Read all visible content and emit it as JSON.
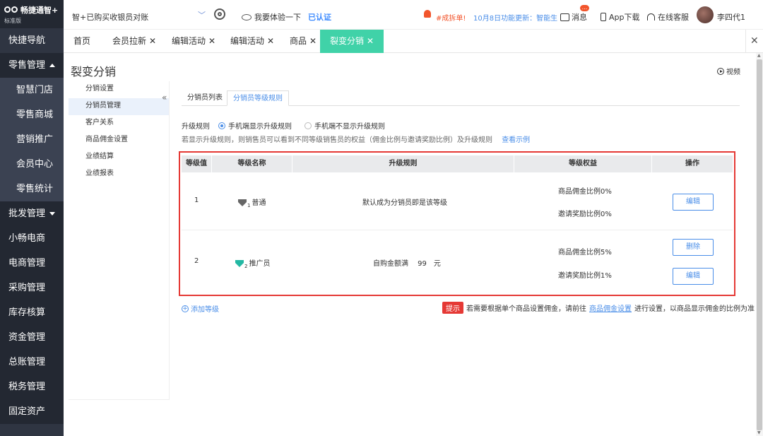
{
  "app": {
    "name": "畅捷通智+",
    "edition": "标准版",
    "store_name": "智+已购买收银员对账"
  },
  "header": {
    "try_label": "我要体验一下",
    "verified_label": "已认证",
    "notice_label": "#成拆单!",
    "update_label": "10月8日功能更新：智能生",
    "message_label": "消息",
    "message_badge": "...",
    "app_download_label": "App下载",
    "support_label": "在线客服",
    "user_name": "李四代1"
  },
  "leftnav": {
    "items": [
      {
        "label": "快捷导航"
      },
      {
        "label": "零售管理"
      },
      {
        "label": "智慧门店"
      },
      {
        "label": "零售商城"
      },
      {
        "label": "营销推广"
      },
      {
        "label": "会员中心"
      },
      {
        "label": "零售统计"
      },
      {
        "label": "批发管理"
      },
      {
        "label": "小畅电商"
      },
      {
        "label": "电商管理"
      },
      {
        "label": "采购管理"
      },
      {
        "label": "库存核算"
      },
      {
        "label": "资金管理"
      },
      {
        "label": "总账管理"
      },
      {
        "label": "税务管理"
      },
      {
        "label": "固定资产"
      }
    ]
  },
  "tabs": [
    {
      "label": "首页"
    },
    {
      "label": "会员拉新"
    },
    {
      "label": "编辑活动"
    },
    {
      "label": "编辑活动"
    },
    {
      "label": "商品"
    },
    {
      "label": "裂变分销"
    }
  ],
  "page": {
    "title": "裂变分销",
    "video_label": "视频"
  },
  "subnav": {
    "items": [
      {
        "label": "分销设置"
      },
      {
        "label": "分销员管理"
      },
      {
        "label": "客户关系"
      },
      {
        "label": "商品佣金设置"
      },
      {
        "label": "业绩结算"
      },
      {
        "label": "业绩报表"
      }
    ]
  },
  "subtabs": [
    {
      "label": "分销员列表"
    },
    {
      "label": "分销员等级规则"
    }
  ],
  "upgrade": {
    "label": "升级规则",
    "option_show": "手机端显示升级规则",
    "option_hide": "手机端不显示升级规则",
    "hint": "若显示升级规则，则销售员可以看到不同等级销售员的权益（佣金比例与邀请奖励比例）及升级规则",
    "example_link": "查看示例"
  },
  "table": {
    "headers": [
      "等级值",
      "等级名称",
      "升级规则",
      "等级权益",
      "操作"
    ],
    "rows": [
      {
        "level": "1",
        "name": "普通",
        "icon_sub": "1",
        "rule": "默认成为分销员即是该等级",
        "commission": "商品佣金比例0%",
        "invite": "邀请奖励比例0%",
        "edit_label": "编辑"
      },
      {
        "level": "2",
        "name": "推广员",
        "icon_sub": "2",
        "rule": "自购金额满　 99　元",
        "commission": "商品佣金比例5%",
        "invite": "邀请奖励比例1%",
        "delete_label": "删除",
        "edit_label": "编辑"
      }
    ]
  },
  "footer": {
    "add_level": "添加等级",
    "tip_badge": "提示",
    "tip_pre": "若需要根据单个商品设置佣金，请前往",
    "tip_link": "商品佣金设置",
    "tip_post": "进行设置，以商品显示佣金的比例为准"
  },
  "colors": {
    "accent": "#40d2a8",
    "link": "#4a8ee8",
    "nav_bg": "#2f3542",
    "highlight_border": "#e53935"
  }
}
